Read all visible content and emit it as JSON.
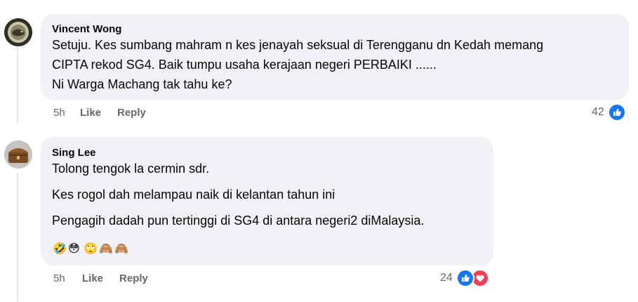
{
  "comments": [
    {
      "author": "Vincent Wong",
      "lines": [
        "Setuju. Kes sumbang mahram n kes jenayah seksual di Terengganu dn Kedah memang",
        "CIPTA rekod SG4. Baik tumpu usaha kerajaan negeri PERBAIKI ......",
        "Ni Warga Machang tak tahu ke?"
      ],
      "time": "5h",
      "like_label": "Like",
      "reply_label": "Reply",
      "reaction_count": "42",
      "reactions": [
        "like-icon"
      ]
    },
    {
      "author": "Sing Lee",
      "lines": [
        "Tolong tengok la cermin sdr.",
        "Kes rogol dah melampau naik di kelantan tahun ini",
        "Pengagih dadah pun tertinggi di SG4 di antara negeri2 diMalaysia."
      ],
      "emojis": [
        "🤣",
        "😳",
        "🙄",
        "🙈",
        "🙈"
      ],
      "time": "5h",
      "like_label": "Like",
      "reply_label": "Reply",
      "reaction_count": "24",
      "reactions": [
        "like-icon",
        "love-icon"
      ]
    }
  ],
  "colors": {
    "bubble": "#f0f2f5",
    "like_blue": "#1877f2",
    "love_red": "#f33e58",
    "meta_gray": "#65676b"
  }
}
